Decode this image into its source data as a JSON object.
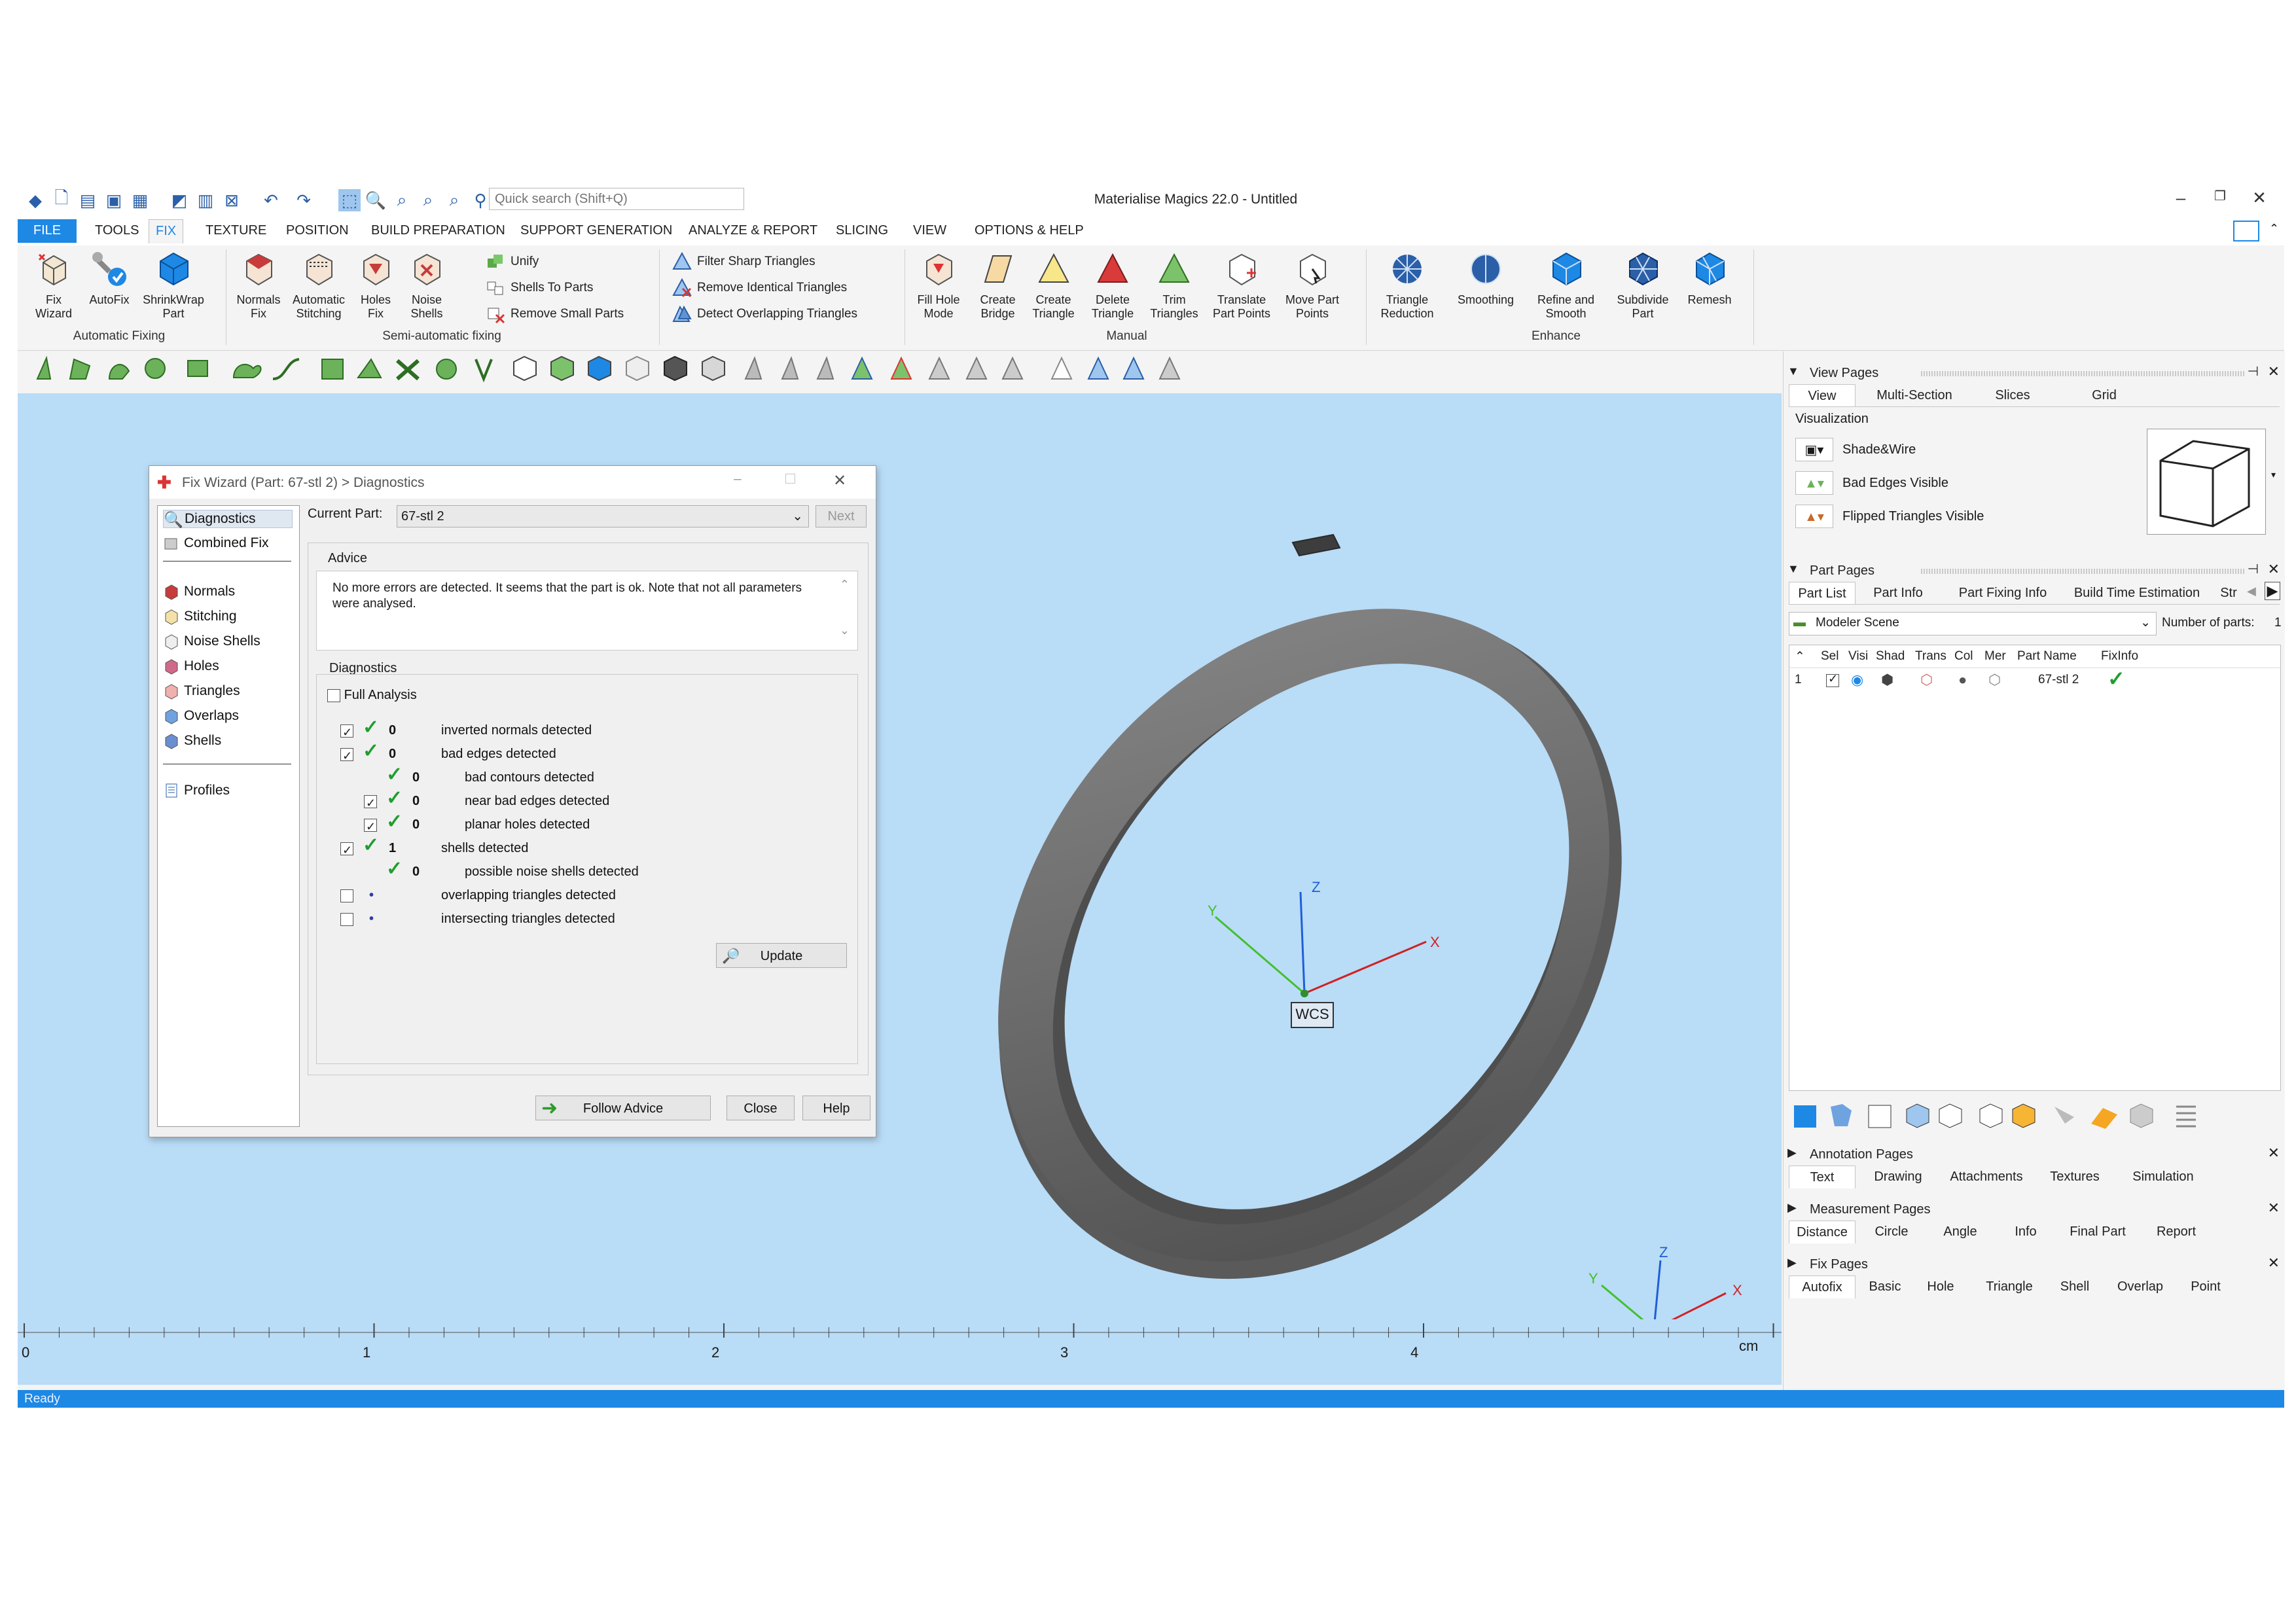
{
  "app": {
    "title": "Materialise Magics 22.0 - Untitled",
    "search_placeholder": "Quick search (Shift+Q)"
  },
  "menu": [
    "FILE",
    "TOOLS",
    "FIX",
    "TEXTURE",
    "POSITION",
    "BUILD PREPARATION",
    "SUPPORT GENERATION",
    "ANALYZE & REPORT",
    "SLICING",
    "VIEW",
    "OPTIONS & HELP"
  ],
  "ribbon": {
    "automatic_fixing": {
      "label": "Automatic Fixing",
      "buttons": [
        "Fix\nWizard",
        "AutoFix",
        "ShrinkWrap\nPart"
      ]
    },
    "semi": {
      "label": "Semi-automatic fixing",
      "buttons": [
        "Normals\nFix",
        "Automatic\nStitching",
        "Holes\nFix",
        "Noise\nShells"
      ],
      "small": [
        "Unify",
        "Shells To Parts",
        "Remove Small Parts"
      ]
    },
    "filters": [
      "Filter Sharp Triangles",
      "Remove Identical Triangles",
      "Detect Overlapping Triangles"
    ],
    "manual": {
      "label": "Manual",
      "buttons": [
        "Fill Hole\nMode",
        "Create\nBridge",
        "Create\nTriangle",
        "Delete\nTriangle",
        "Trim\nTriangles",
        "Translate\nPart Points",
        "Move Part\nPoints"
      ]
    },
    "enhance": {
      "label": "Enhance",
      "buttons": [
        "Triangle\nReduction",
        "Smoothing",
        "Refine and\nSmooth",
        "Subdivide\nPart",
        "Remesh"
      ]
    }
  },
  "viewport": {
    "wcs": "WCS",
    "axis_x": "X",
    "axis_y": "Y",
    "axis_z": "Z",
    "ruler": [
      "0",
      "1",
      "2",
      "3",
      "4"
    ],
    "ruler_unit": "cm"
  },
  "status": "Ready",
  "dialog": {
    "title": "Fix Wizard (Part: 67-stl 2) > Diagnostics",
    "nav_top": [
      "Diagnostics",
      "Combined Fix"
    ],
    "nav_items": [
      "Normals",
      "Stitching",
      "Noise Shells",
      "Holes",
      "Triangles",
      "Overlaps",
      "Shells"
    ],
    "nav_bottom": [
      "Profiles"
    ],
    "current_part_label": "Current Part:",
    "current_part": "67-stl 2",
    "next": "Next",
    "advice_label": "Advice",
    "advice_text": "No more errors are detected. It seems that the part is ok. Note that not all parameters were analysed.",
    "diagnostics_label": "Diagnostics",
    "full_analysis": "Full Analysis",
    "rows": [
      {
        "checked": true,
        "status": "ok",
        "count": "0",
        "text": "inverted normals detected",
        "indent": 0
      },
      {
        "checked": true,
        "status": "ok",
        "count": "0",
        "text": "bad edges detected",
        "indent": 0
      },
      {
        "checked": null,
        "status": "ok",
        "count": "0",
        "text": "bad contours detected",
        "indent": 1
      },
      {
        "checked": true,
        "status": "ok",
        "count": "0",
        "text": "near bad edges detected",
        "indent": 1
      },
      {
        "checked": true,
        "status": "ok",
        "count": "0",
        "text": "planar holes detected",
        "indent": 1
      },
      {
        "checked": true,
        "status": "ok",
        "count": "1",
        "text": "shells detected",
        "indent": 0
      },
      {
        "checked": null,
        "status": "ok",
        "count": "0",
        "text": "possible noise shells detected",
        "indent": 1
      },
      {
        "checked": false,
        "status": "dot",
        "count": "",
        "text": "overlapping triangles detected",
        "indent": 0
      },
      {
        "checked": false,
        "status": "dot",
        "count": "",
        "text": "intersecting triangles detected",
        "indent": 0
      }
    ],
    "update": "Update",
    "follow_advice": "Follow Advice",
    "close": "Close",
    "help": "Help"
  },
  "dock": {
    "view_pages": "View Pages",
    "view_tabs": [
      "View",
      "Multi-Section",
      "Slices",
      "Grid"
    ],
    "visualization": "Visualization",
    "vis_items": [
      "Shade&Wire",
      "Bad Edges Visible",
      "Flipped Triangles Visible"
    ],
    "part_pages": "Part Pages",
    "part_tabs": [
      "Part List",
      "Part Info",
      "Part Fixing Info",
      "Build Time Estimation",
      "Str"
    ],
    "scene": "Modeler Scene",
    "num_parts_label": "Number of parts:",
    "num_parts": "1",
    "columns": [
      "Sel",
      "Visi",
      "Shad",
      "Trans",
      "Col",
      "Mer",
      "Part Name",
      "FixInfo"
    ],
    "part_row": {
      "index": "1",
      "name": "67-stl 2"
    },
    "annotation_pages": "Annotation Pages",
    "annotation_tabs": [
      "Text",
      "Drawing",
      "Attachments",
      "Textures",
      "Simulation"
    ],
    "measurement_pages": "Measurement Pages",
    "measurement_tabs": [
      "Distance",
      "Circle",
      "Angle",
      "Info",
      "Final Part",
      "Report"
    ],
    "fix_pages": "Fix Pages",
    "fix_tabs": [
      "Autofix",
      "Basic",
      "Hole",
      "Triangle",
      "Shell",
      "Overlap",
      "Point"
    ]
  },
  "colors": {
    "accent": "#1e88e5",
    "viewport": "#b9dcf7",
    "ok": "#1f9e2e"
  }
}
